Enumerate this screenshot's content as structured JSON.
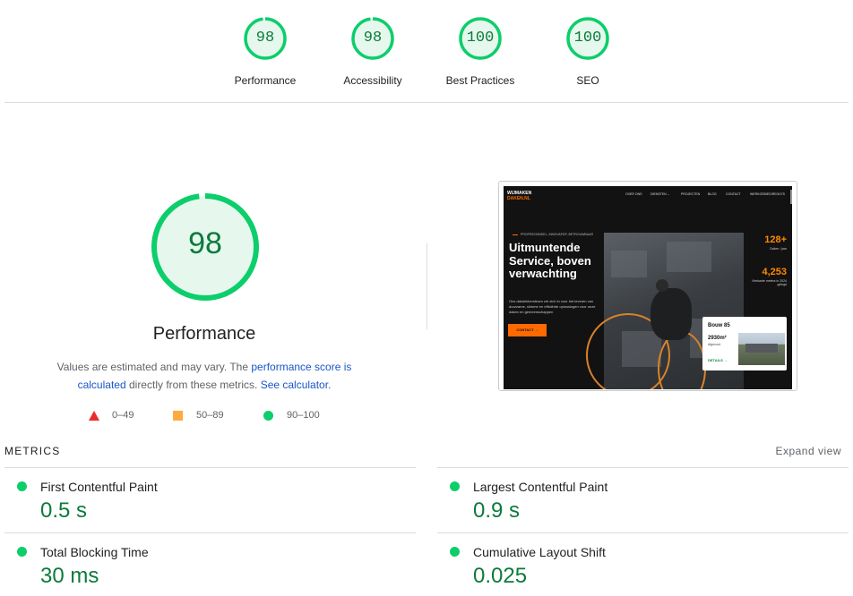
{
  "scores": [
    {
      "label": "Performance",
      "value": "98",
      "fraction": 0.98
    },
    {
      "label": "Accessibility",
      "value": "98",
      "fraction": 0.98
    },
    {
      "label": "Best Practices",
      "value": "100",
      "fraction": 1.0
    },
    {
      "label": "SEO",
      "value": "100",
      "fraction": 1.0
    }
  ],
  "main": {
    "score": "98",
    "score_fraction": 0.98,
    "title": "Performance",
    "desc_prefix": "Values are estimated and may vary. The ",
    "desc_link1": "performance score is calculated",
    "desc_middle": " directly from these metrics. ",
    "desc_link2": "See calculator."
  },
  "legend": [
    {
      "icon": "red-triangle",
      "label": "0–49",
      "color": "#eb2b2b"
    },
    {
      "icon": "orange-square",
      "label": "50–89",
      "color": "#fdab40"
    },
    {
      "icon": "green-circle",
      "label": "90–100",
      "color": "#0cce6b"
    }
  ],
  "screenshot": {
    "logo_line1": "WIJMAKEN",
    "logo_line2": "DAKEN.NL",
    "nav": [
      "OVER ONS",
      "DIENSTEN ⌄",
      "PROJECTEN",
      "BLOG",
      "CONTACT",
      "WERKGEBIED/REGIO'S"
    ],
    "kicker": "PROFESSIONEEL, INNOVATIEF, BETROUWBAAR",
    "headline": "Uitmuntende Service, boven verwachting",
    "subtext": "Ons dakdekkersteam zet zich in voor het leveren van duurzame, slimme en efficiënte oplossingen voor onze daken en gemeenschappen",
    "cta": "CONTACT →",
    "stat1": "128+",
    "stat1_label": "Daken / jaar",
    "stat2": "4,253",
    "stat2_label": "Vierkante meters in 2024 gelegd",
    "card_title": "Bouw 85",
    "card_metric": "2930m²",
    "card_metric_label": "Afgerond",
    "card_link": "DETAILS →"
  },
  "metrics": {
    "heading": "METRICS",
    "expand": "Expand view",
    "items": [
      {
        "name": "First Contentful Paint",
        "value": "0.5 s"
      },
      {
        "name": "Largest Contentful Paint",
        "value": "0.9 s"
      },
      {
        "name": "Total Blocking Time",
        "value": "30 ms"
      },
      {
        "name": "Cumulative Layout Shift",
        "value": "0.025"
      }
    ]
  },
  "colors": {
    "pass": "#0cce6b",
    "pass_text": "#0c7a3b",
    "pass_bg": "#e6f8ee",
    "link": "#1a56c9"
  }
}
